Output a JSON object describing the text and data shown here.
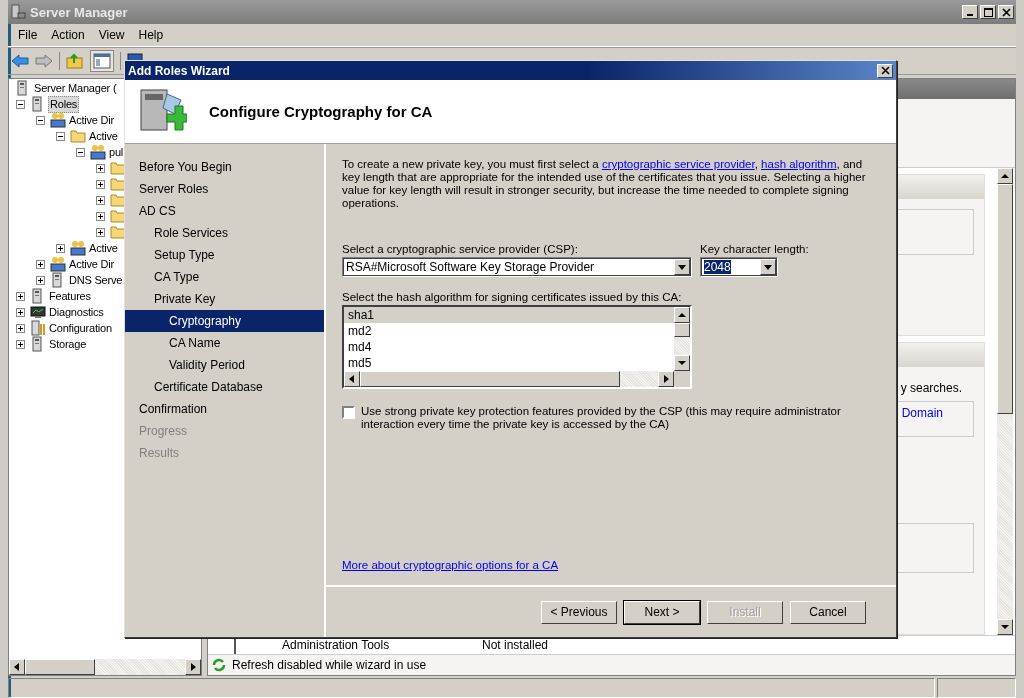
{
  "window": {
    "title": "Server Manager"
  },
  "menu": [
    "File",
    "Action",
    "View",
    "Help"
  ],
  "tree": [
    {
      "label": "Server Manager (",
      "kind": "server",
      "selected": false,
      "children": [
        {
          "label": "Roles",
          "kind": "server",
          "selected": true,
          "expanded": true,
          "children": [
            {
              "label": "Active Dir",
              "kind": "people",
              "selected": false,
              "expanded": true,
              "children": [
                {
                  "label": "Active",
                  "kind": "folder",
                  "selected": false,
                  "expanded": true,
                  "children": [
                    {
                      "label": "pul",
                      "kind": "people",
                      "selected": false,
                      "expanded": true,
                      "children": [
                        {
                          "kind": "folder",
                          "selected": false,
                          "expanded": false
                        },
                        {
                          "kind": "folder",
                          "selected": false,
                          "expanded": false
                        },
                        {
                          "kind": "folder",
                          "selected": false,
                          "expanded": false
                        },
                        {
                          "kind": "folder",
                          "selected": false,
                          "expanded": false
                        },
                        {
                          "kind": "folder",
                          "selected": false,
                          "expanded": false
                        }
                      ]
                    }
                  ]
                },
                {
                  "label": "Active",
                  "kind": "people",
                  "selected": false,
                  "expanded": false
                }
              ]
            },
            {
              "label": "Active Dir",
              "kind": "people",
              "selected": false,
              "expanded": false
            },
            {
              "label": "DNS Serve",
              "kind": "server",
              "selected": false,
              "expanded": false
            }
          ]
        },
        {
          "label": "Features",
          "kind": "server",
          "selected": false,
          "expanded": false
        },
        {
          "label": "Diagnostics",
          "kind": "monitor",
          "selected": false,
          "expanded": false
        },
        {
          "label": "Configuration",
          "kind": "wrench",
          "selected": false,
          "expanded": false
        },
        {
          "label": "Storage",
          "kind": "server",
          "selected": false,
          "expanded": false
        }
      ]
    }
  ],
  "right_panel": {
    "text": "y searches.",
    "link": "Domain"
  },
  "table_row": {
    "name": "Administration Tools",
    "status": "Not installed"
  },
  "status_message": "Refresh disabled while wizard in use",
  "wizard": {
    "title": "Add Roles Wizard",
    "heading": "Configure Cryptography for CA",
    "steps": [
      {
        "label": "Before You Begin",
        "selected": false,
        "disabled": false
      },
      {
        "label": "Server Roles",
        "selected": false,
        "disabled": false
      },
      {
        "label": "AD CS",
        "selected": false,
        "disabled": false,
        "children": [
          {
            "label": "Role Services",
            "selected": false,
            "disabled": false
          },
          {
            "label": "Setup Type",
            "selected": false,
            "disabled": false
          },
          {
            "label": "CA Type",
            "selected": false,
            "disabled": false
          },
          {
            "label": "Private Key",
            "selected": false,
            "disabled": false,
            "children": [
              {
                "label": "Cryptography",
                "selected": true,
                "disabled": false
              },
              {
                "label": "CA Name",
                "selected": false,
                "disabled": false
              },
              {
                "label": "Validity Period",
                "selected": false,
                "disabled": false
              }
            ]
          },
          {
            "label": "Certificate Database",
            "selected": false,
            "disabled": false
          }
        ]
      },
      {
        "label": "Confirmation",
        "selected": false,
        "disabled": false
      },
      {
        "label": "Progress",
        "selected": false,
        "disabled": true
      },
      {
        "label": "Results",
        "selected": false,
        "disabled": true
      }
    ],
    "description": [
      {
        "kind": "text",
        "text": "To create a new private key, you must first select a "
      },
      {
        "kind": "link",
        "text": "cryptographic service provider"
      },
      {
        "kind": "text",
        "text": ", "
      },
      {
        "kind": "link",
        "text": "hash algorithm"
      },
      {
        "kind": "text",
        "text": ", and key length that are appropriate for the intended use of the certificates that you issue. Selecting a higher value for key length will result in stronger security, but increase the time needed to complete signing operations."
      }
    ],
    "csp": {
      "label": "Select a cryptographic service provider (CSP):",
      "value": "RSA#Microsoft Software Key Storage Provider"
    },
    "key_length": {
      "label": "Key character length:",
      "value": "2048"
    },
    "hash": {
      "label": "Select the hash algorithm for signing certificates issued by this CA:",
      "items": [
        {
          "label": "sha1",
          "selected": true
        },
        {
          "label": "md2",
          "selected": false
        },
        {
          "label": "md4",
          "selected": false
        },
        {
          "label": "md5",
          "selected": false
        }
      ]
    },
    "strong_protection": {
      "label": "Use strong private key protection features provided by the CSP (this may require administrator interaction every time the private key is accessed by the CA)",
      "checked": false
    },
    "help_link": "More about cryptographic options for a CA",
    "buttons": [
      {
        "label": "< Previous",
        "disabled": false,
        "default": false
      },
      {
        "label": "Next >",
        "disabled": false,
        "default": true
      },
      {
        "label": "Install",
        "disabled": true,
        "default": false
      },
      {
        "label": "Cancel",
        "disabled": false,
        "default": false
      }
    ]
  }
}
